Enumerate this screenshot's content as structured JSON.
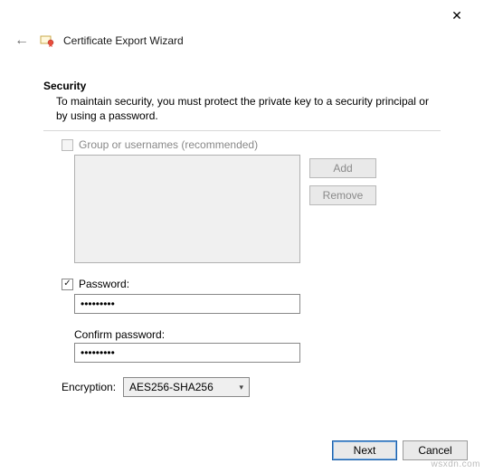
{
  "window": {
    "close_glyph": "✕"
  },
  "header": {
    "back_glyph": "←",
    "title": "Certificate Export Wizard"
  },
  "section": {
    "heading": "Security",
    "description": "To maintain security, you must protect the private key to a security principal or by using a password."
  },
  "group_option": {
    "label": "Group or usernames (recommended)"
  },
  "buttons": {
    "add": "Add",
    "remove": "Remove"
  },
  "password_option": {
    "label": "Password:",
    "value": "•••••••••",
    "confirm_label": "Confirm password:",
    "confirm_value": "•••••••••"
  },
  "encryption": {
    "label": "Encryption:",
    "selected": "AES256-SHA256"
  },
  "footer": {
    "next": "Next",
    "cancel": "Cancel"
  },
  "watermark": "wsxdn.com"
}
